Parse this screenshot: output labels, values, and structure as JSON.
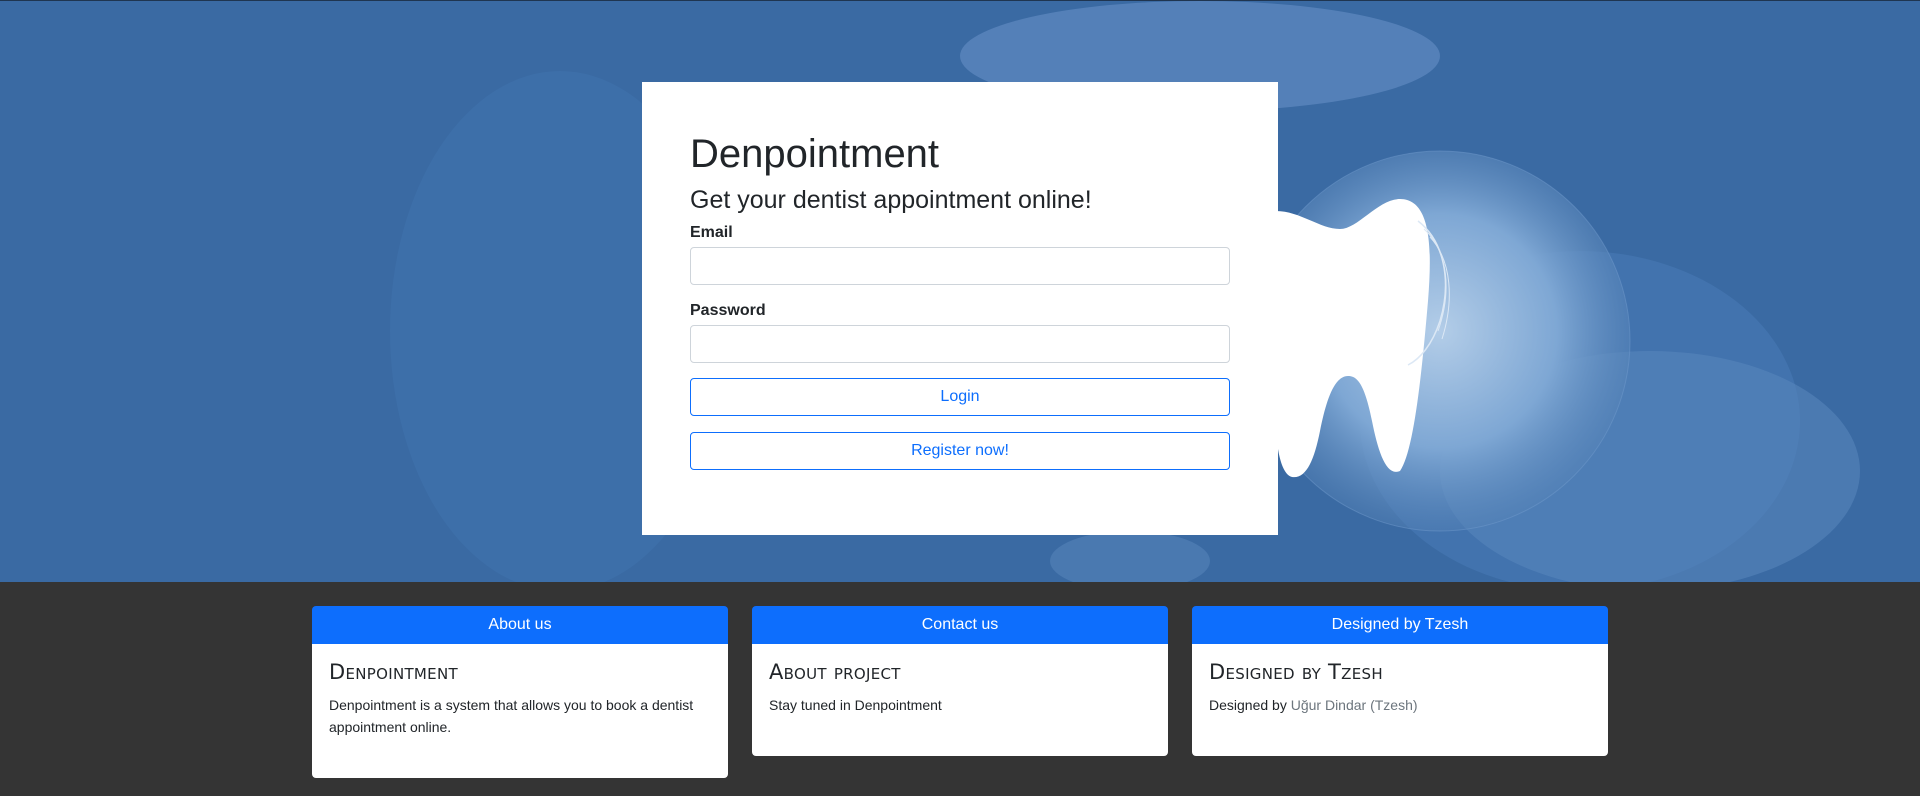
{
  "colors": {
    "hero_background": "#3a6aa3",
    "footer_background": "#343434",
    "primary": "#0d6efd",
    "text": "#212529"
  },
  "login": {
    "title": "Denpointment",
    "subtitle": "Get your dentist appointment online!",
    "email_label": "Email",
    "email_value": "",
    "password_label": "Password",
    "password_value": "",
    "login_button": "Login",
    "register_button": "Register now!"
  },
  "hero": {
    "icon": "tooth-icon"
  },
  "footer": {
    "cards": [
      {
        "header": "About us",
        "title": "Denpointment",
        "text": "Denpointment is a system that allows you to book a dentist appointment online."
      },
      {
        "header": "Contact us",
        "title": "About project",
        "text": "Stay tuned in Denpointment"
      },
      {
        "header": "Designed by Tzesh",
        "title": "Designed by Tzesh",
        "text_prefix": "Designed by ",
        "link_text": "Uğur Dindar (Tzesh)"
      }
    ]
  }
}
